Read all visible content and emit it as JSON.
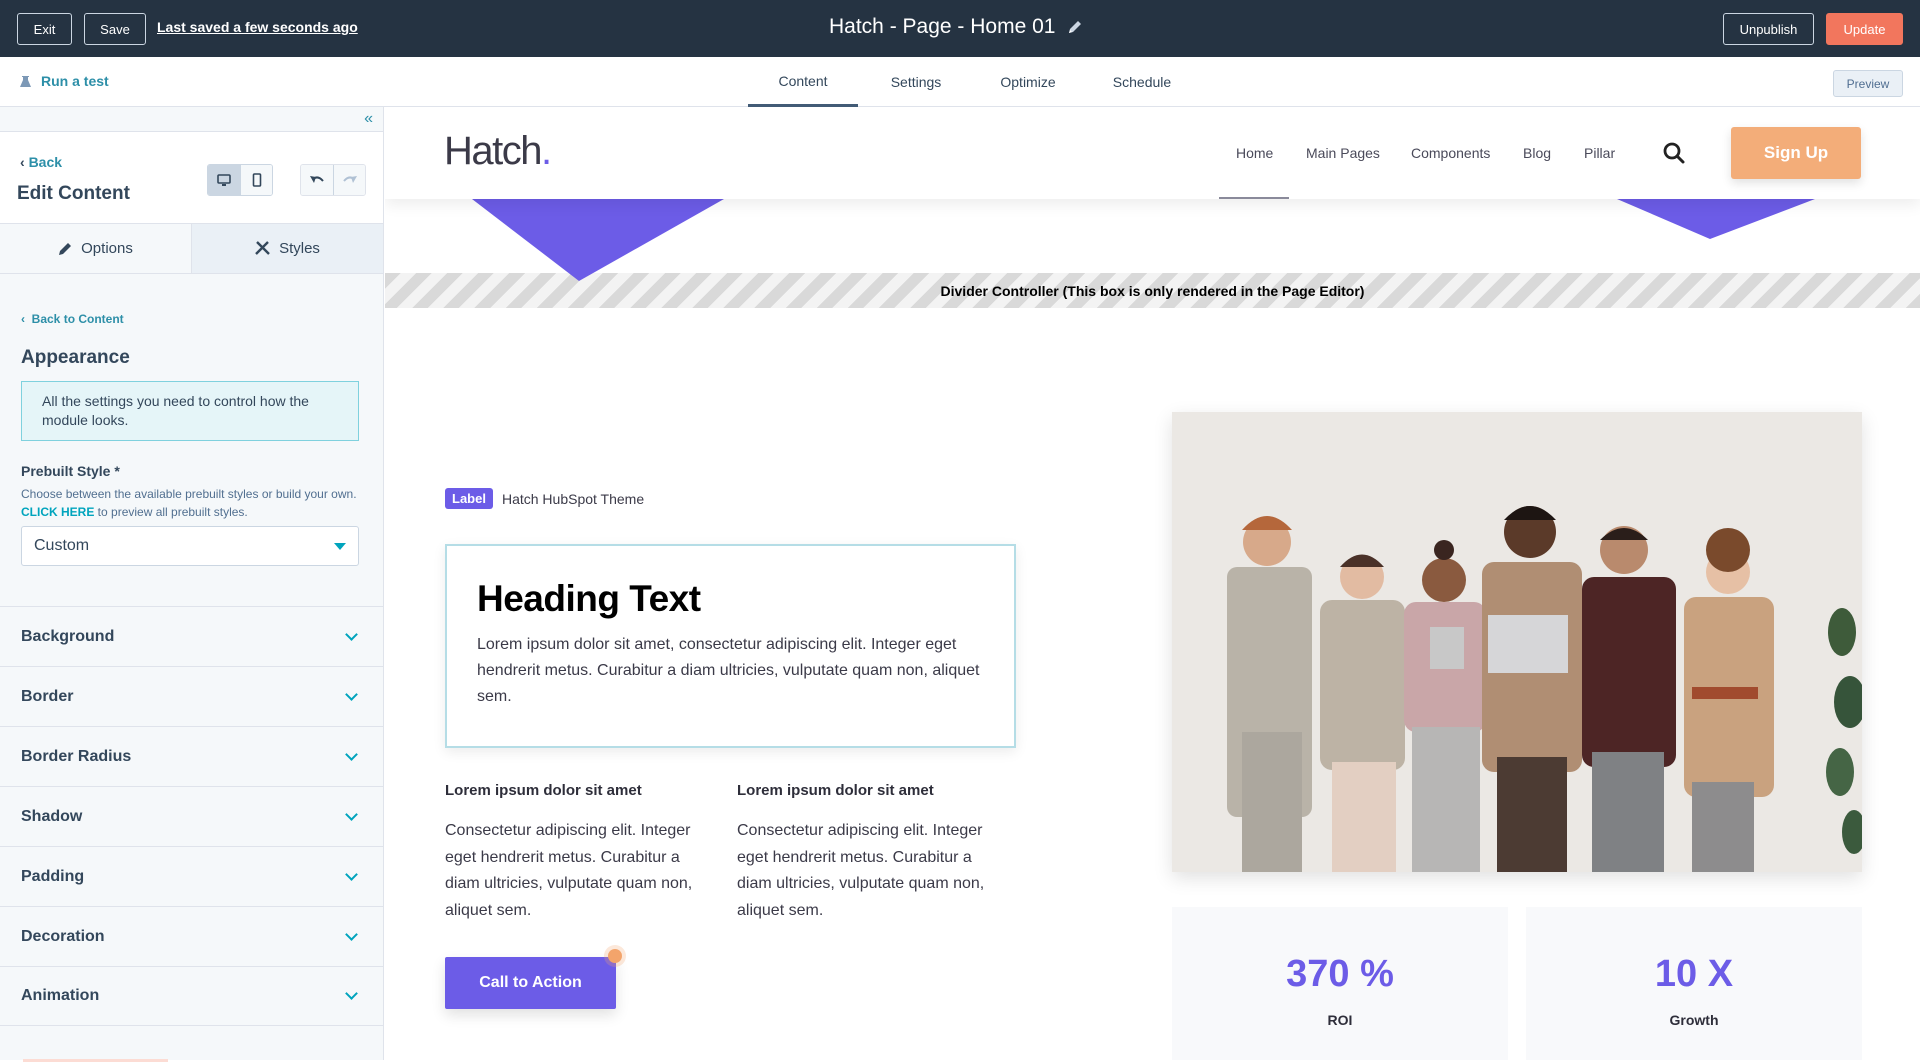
{
  "topbar": {
    "exit_label": "Exit",
    "save_label": "Save",
    "last_saved": "Last saved a few seconds ago",
    "page_title": "Hatch - Page - Home 01",
    "unpublish_label": "Unpublish",
    "update_label": "Update",
    "update_color": "#f2765d"
  },
  "subbar": {
    "run_test_label": "Run a test",
    "tabs": [
      {
        "label": "Content",
        "active": true
      },
      {
        "label": "Settings",
        "active": false
      },
      {
        "label": "Optimize",
        "active": false
      },
      {
        "label": "Schedule",
        "active": false
      }
    ],
    "preview_label": "Preview"
  },
  "sidebar": {
    "back_label": "Back",
    "title": "Edit Content",
    "device_active": "desktop",
    "tabs": [
      {
        "label": "Options",
        "icon": "pencil-icon",
        "active": true
      },
      {
        "label": "Styles",
        "icon": "styles-icon",
        "active": false
      }
    ],
    "back_to_content": "Back to Content",
    "section_title": "Appearance",
    "info_text": "All the settings you need to control how the module looks.",
    "prebuilt_label": "Prebuilt Style *",
    "prebuilt_help_before": "Choose between the available prebuilt styles or build your own. ",
    "prebuilt_help_link": "CLICK HERE",
    "prebuilt_help_after": " to preview all prebuilt styles.",
    "prebuilt_value": "Custom",
    "accordion": [
      "Background",
      "Border",
      "Border Radius",
      "Shadow",
      "Padding",
      "Decoration",
      "Animation"
    ]
  },
  "site": {
    "logo_text": "Hatch",
    "logo_dot": ".",
    "nav": [
      "Home",
      "Main Pages",
      "Components",
      "Blog",
      "Pillar"
    ],
    "signup_label": "Sign Up",
    "divider_text": "Divider Controller (This box is only rendered in the Page Editor)",
    "badge": "Label",
    "badge_text": "Hatch HubSpot Theme",
    "heading": "Heading Text",
    "heading_body": "Lorem ipsum dolor sit amet, consectetur adipiscing elit. Integer eget hendrerit metus. Curabitur a diam ultricies, vulputate quam non, aliquet sem.",
    "features": [
      {
        "title": "Lorem ipsum dolor sit amet",
        "body": "Consectetur adipiscing elit. Integer eget hendrerit metus. Curabitur a diam ultricies, vulputate quam non, aliquet sem."
      },
      {
        "title": "Lorem ipsum dolor sit amet",
        "body": "Consectetur adipiscing elit. Integer eget hendrerit metus. Curabitur a diam ultricies, vulputate quam non, aliquet sem."
      }
    ],
    "cta_label": "Call to Action",
    "stats": [
      {
        "value": "370 %",
        "label": "ROI"
      },
      {
        "value": "10 X",
        "label": "Growth"
      }
    ],
    "accent_color": "#6c5ce7",
    "signup_color": "#f3ad79"
  }
}
